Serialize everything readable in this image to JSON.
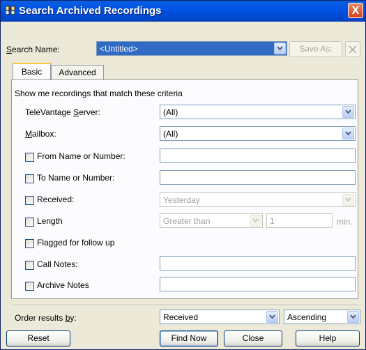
{
  "window": {
    "title": "Search Archived Recordings",
    "close_label": "X"
  },
  "search_name": {
    "label": "Search Name:",
    "value": "<Untitled>",
    "save_as_label": "Save As:",
    "delete_label": "X"
  },
  "tabs": [
    {
      "label": "Basic",
      "selected": true
    },
    {
      "label": "Advanced",
      "selected": false
    }
  ],
  "criteria": {
    "heading": "Show me recordings that match these criteria",
    "server": {
      "label": "TeleVantage Server:",
      "value": "(All)"
    },
    "mailbox": {
      "label": "Mailbox:",
      "value": "(All)"
    },
    "from": {
      "label": "From Name or Number:",
      "checked": false,
      "value": ""
    },
    "to": {
      "label": "To Name or Number:",
      "checked": false,
      "value": ""
    },
    "received": {
      "label": "Received:",
      "checked": false,
      "value": "Yesterday"
    },
    "length": {
      "label": "Length",
      "checked": false,
      "operator": "Greater than",
      "value": "1",
      "unit": "min."
    },
    "flagged": {
      "label": "Flagged for follow up",
      "checked": false
    },
    "call_notes": {
      "label": "Call Notes:",
      "checked": false,
      "value": ""
    },
    "archive_notes": {
      "label": "Archive Notes",
      "checked": false,
      "value": ""
    }
  },
  "order": {
    "label": "Order results by:",
    "field": "Received",
    "direction": "Ascending"
  },
  "buttons": {
    "reset": "Reset",
    "find_now": "Find Now",
    "close": "Close",
    "help": "Help"
  }
}
